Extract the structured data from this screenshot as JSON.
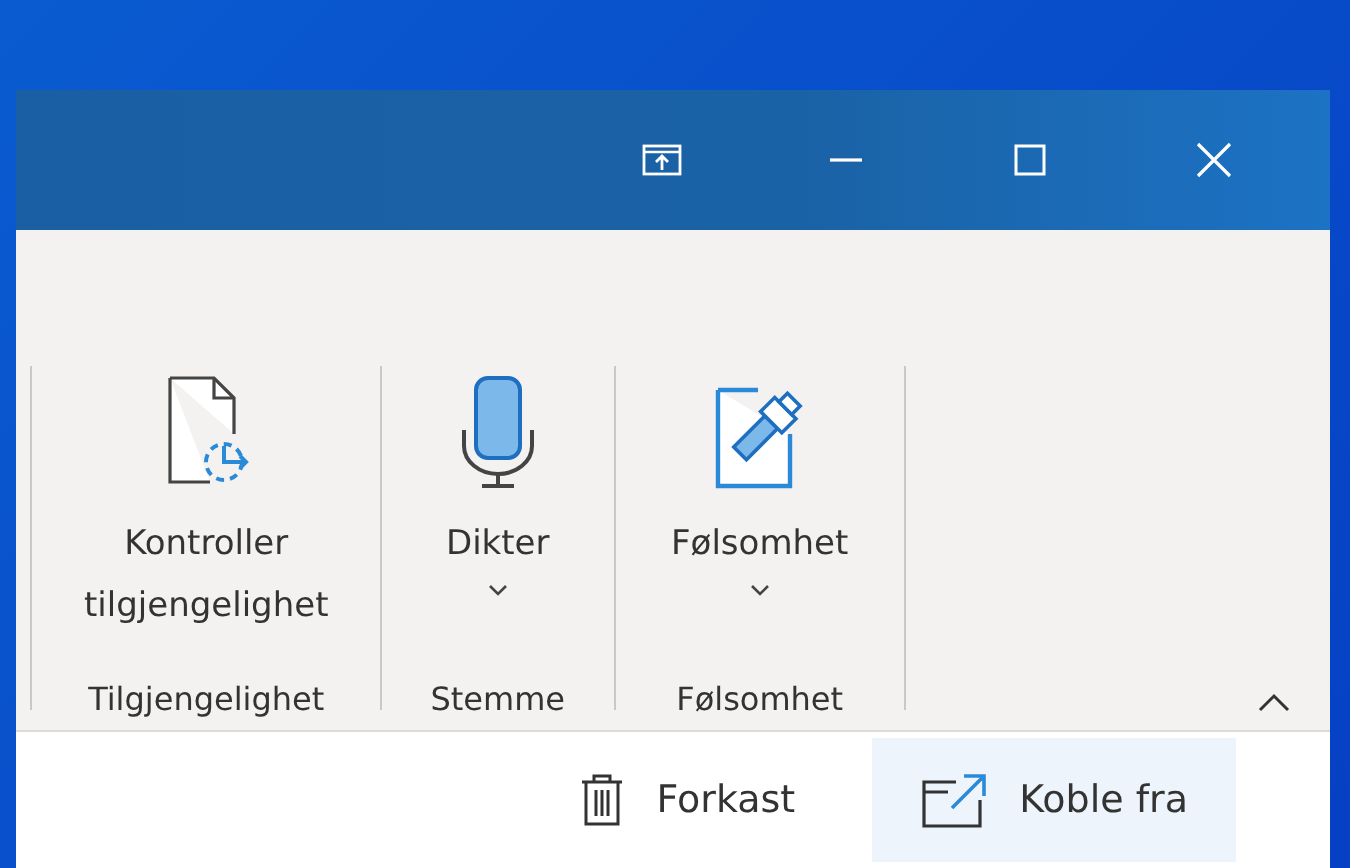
{
  "title_bar": {
    "buttons": [
      {
        "kind": "popout"
      },
      {
        "kind": "minimize"
      },
      {
        "kind": "maximize"
      },
      {
        "kind": "close"
      }
    ]
  },
  "ribbon": {
    "groups": [
      {
        "label": "Tilgjengelighet",
        "commands": [
          {
            "kind": "accessibility",
            "label": "Kontroller tilgjengelighet",
            "dropdown": false
          }
        ]
      },
      {
        "label": "Stemme",
        "commands": [
          {
            "kind": "dictate",
            "label": "Dikter",
            "dropdown": true
          }
        ]
      },
      {
        "label": "Følsomhet",
        "commands": [
          {
            "kind": "sensitivity",
            "label": "Følsomhet",
            "dropdown": true
          }
        ]
      }
    ]
  },
  "actions": [
    {
      "kind": "discard",
      "label": "Forkast",
      "highlighted": false
    },
    {
      "kind": "disconnect",
      "label": "Koble fra",
      "highlighted": true
    }
  ]
}
